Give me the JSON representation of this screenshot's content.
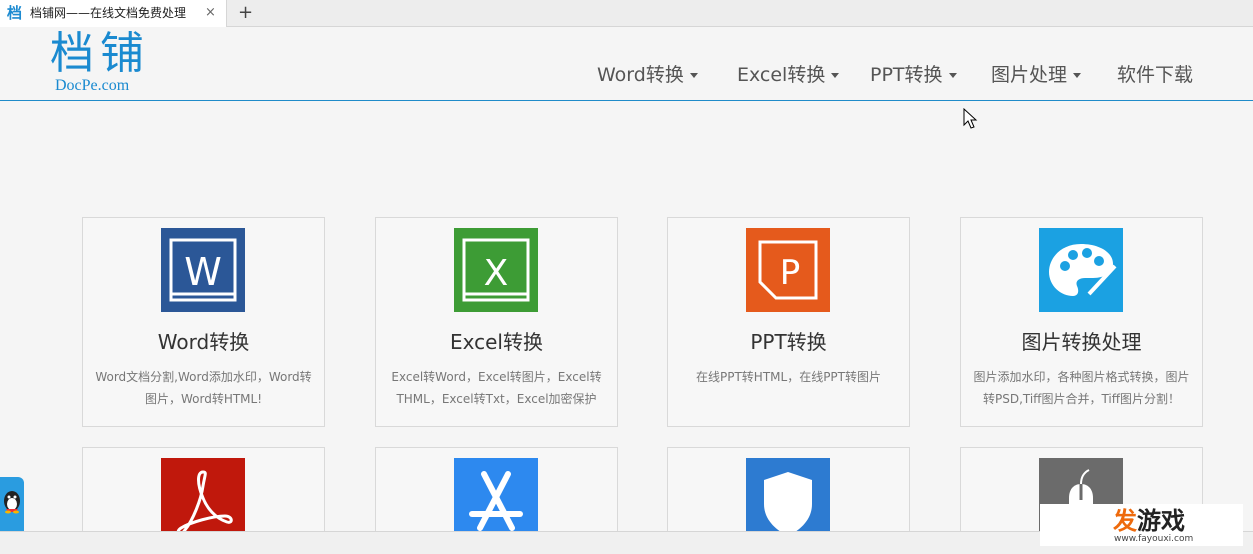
{
  "browser": {
    "tab_favicon": "档",
    "tab_title": "档铺网——在线文档免费处理",
    "close_glyph": "×",
    "new_tab_glyph": "+"
  },
  "header": {
    "logo_cn": "档铺",
    "logo_en": "DocPe.com",
    "nav": [
      {
        "label": "Word转换",
        "dropdown": true
      },
      {
        "label": "Excel转换",
        "dropdown": true
      },
      {
        "label": "PPT转换",
        "dropdown": true
      },
      {
        "label": "图片处理",
        "dropdown": true
      },
      {
        "label": "软件下载",
        "dropdown": false
      }
    ]
  },
  "cards": [
    {
      "title": "Word转换",
      "desc": "Word文档分割,Word添加水印，Word转图片，Word转HTML!",
      "icon": "word-icon",
      "color": "#2b5797"
    },
    {
      "title": "Excel转换",
      "desc": "Excel转Word，Excel转图片，Excel转THML，Excel转Txt，Excel加密保护",
      "icon": "excel-icon",
      "color": "#3d9c35"
    },
    {
      "title": "PPT转换",
      "desc": "在线PPT转HTML，在线PPT转图片",
      "icon": "ppt-icon",
      "color": "#e55a1c"
    },
    {
      "title": "图片转换处理",
      "desc": "图片添加水印，各种图片格式转换，图片转PSD,Tiff图片合并，Tiff图片分割！",
      "icon": "palette-icon",
      "color": "#1ba1e2"
    },
    {
      "title": "",
      "desc": "",
      "icon": "pdf-icon",
      "color": "#c0180c"
    },
    {
      "title": "",
      "desc": "",
      "icon": "app-store-icon",
      "color": "#2d89ef"
    },
    {
      "title": "",
      "desc": "",
      "icon": "shield-icon",
      "color": "#2d7bd1"
    },
    {
      "title": "",
      "desc": "",
      "icon": "mouse-icon",
      "color": "#6b6b6b"
    }
  ],
  "watermark": {
    "fa": "发",
    "rest": "游戏",
    "url": "www.fayouxi.com"
  }
}
